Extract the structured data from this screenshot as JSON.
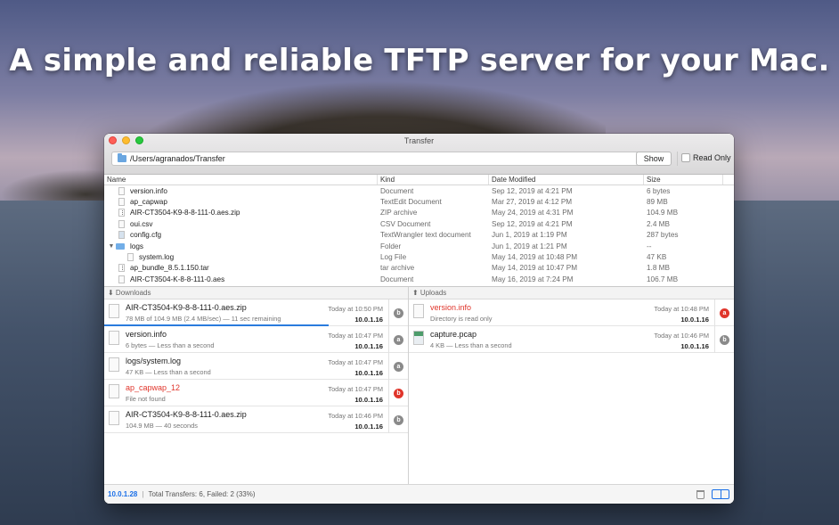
{
  "headline": "A simple and reliable TFTP server for your Mac.",
  "window": {
    "title": "Transfer",
    "path": "/Users/agranados/Transfer",
    "show_label": "Show",
    "read_only_label": "Read Only"
  },
  "file_list": {
    "columns": {
      "name": "Name",
      "kind": "Kind",
      "date": "Date Modified",
      "size": "Size"
    },
    "rows": [
      {
        "name": "version.info",
        "kind": "Document",
        "date": "Sep 12, 2019 at 4:21 PM",
        "size": "6 bytes"
      },
      {
        "name": "ap_capwap",
        "kind": "TextEdit Document",
        "date": "Mar 27, 2019 at 4:12 PM",
        "size": "89 MB"
      },
      {
        "name": "AIR-CT3504-K9-8-8-111-0.aes.zip",
        "kind": "ZIP archive",
        "date": "May 24, 2019 at 4:31 PM",
        "size": "104.9 MB"
      },
      {
        "name": "oui.csv",
        "kind": "CSV Document",
        "date": "Sep 12, 2019 at 4:21 PM",
        "size": "2.4 MB"
      },
      {
        "name": "config.cfg",
        "kind": "TextWrangler text document",
        "date": "Jun 1, 2019 at 1:19 PM",
        "size": "287 bytes"
      },
      {
        "name": "logs",
        "kind": "Folder",
        "date": "Jun 1, 2019 at 1:21 PM",
        "size": "--"
      },
      {
        "name": "system.log",
        "kind": "Log File",
        "date": "May 14, 2019 at 10:48 PM",
        "size": "47 KB"
      },
      {
        "name": "ap_bundle_8.5.1.150.tar",
        "kind": "tar archive",
        "date": "May 14, 2019 at 10:47 PM",
        "size": "1.8 MB"
      },
      {
        "name": "AIR-CT3504-K-8-8-111-0.aes",
        "kind": "Document",
        "date": "May 16, 2019 at 7:24 PM",
        "size": "106.7 MB"
      }
    ]
  },
  "downloads": {
    "header": "⬇ Downloads",
    "items": [
      {
        "name": "AIR-CT3504-K9-8-8-111-0.aes.zip",
        "detail": "78 MB of 104.9 MB (2.4 MB/sec) — 11 sec remaining",
        "when": "Today at 10:50 PM",
        "ip": "10.0.1.16",
        "badge": "b",
        "error": false,
        "progress": 0.74
      },
      {
        "name": "version.info",
        "detail": "6 bytes — Less than a second",
        "when": "Today at 10:47 PM",
        "ip": "10.0.1.16",
        "badge": "a",
        "error": false
      },
      {
        "name": "logs/system.log",
        "detail": "47 KB — Less than a second",
        "when": "Today at 10:47 PM",
        "ip": "10.0.1.16",
        "badge": "a",
        "error": false
      },
      {
        "name": "ap_capwap_12",
        "detail": "File not found",
        "when": "Today at 10:47 PM",
        "ip": "10.0.1.16",
        "badge": "b",
        "error": true
      },
      {
        "name": "AIR-CT3504-K9-8-8-111-0.aes.zip",
        "detail": "104.9 MB — 40 seconds",
        "when": "Today at 10:46 PM",
        "ip": "10.0.1.16",
        "badge": "b",
        "error": false
      }
    ]
  },
  "uploads": {
    "header": "⬆ Uploads",
    "items": [
      {
        "name": "version.info",
        "detail": "Directory is read only",
        "when": "Today at 10:48 PM",
        "ip": "10.0.1.16",
        "badge": "a",
        "error": true
      },
      {
        "name": "capture.pcap",
        "detail": "4 KB — Less than a second",
        "when": "Today at 10:46 PM",
        "ip": "10.0.1.16",
        "badge": "b",
        "error": false
      }
    ]
  },
  "status": {
    "ip": "10.0.1.28",
    "summary": "Total Transfers: 6, Failed: 2 (33%)"
  },
  "colors": {
    "accent": "#1a6fe8",
    "error": "#e0352b",
    "badge_gray": "#8a8a8a"
  }
}
